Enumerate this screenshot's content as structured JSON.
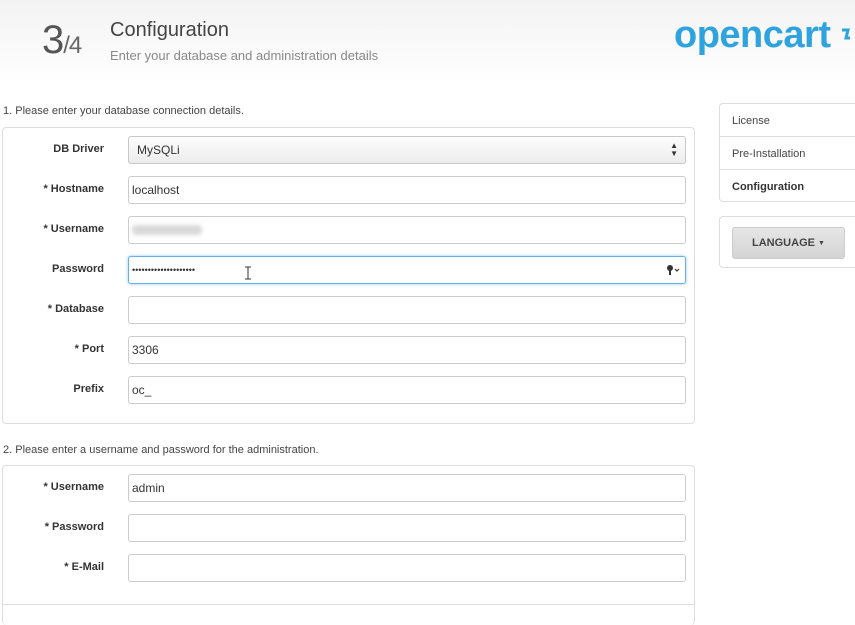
{
  "header": {
    "step_current": "3",
    "step_total": "/4",
    "title": "Configuration",
    "subtitle": "Enter your database and administration details",
    "logo_text": "opencart",
    "logo_color": "#2fa3dd"
  },
  "db_section": {
    "heading": "1. Please enter your database connection details.",
    "fields": {
      "driver": {
        "label": "DB Driver",
        "value": "MySQLi"
      },
      "hostname": {
        "label": "* Hostname",
        "value": "localhost"
      },
      "username": {
        "label": "* Username",
        "value": ""
      },
      "password": {
        "label": "Password",
        "value": "••••••••••••••••••••"
      },
      "database": {
        "label": "* Database",
        "value": ""
      },
      "port": {
        "label": "* Port",
        "value": "3306"
      },
      "prefix": {
        "label": "Prefix",
        "value": "oc_"
      }
    }
  },
  "admin_section": {
    "heading": "2. Please enter a username and password for the administration.",
    "fields": {
      "username": {
        "label": "* Username",
        "value": "admin"
      },
      "password": {
        "label": "* Password",
        "value": ""
      },
      "email": {
        "label": "* E-Mail",
        "value": ""
      }
    }
  },
  "sidebar": {
    "steps": [
      {
        "label": "License"
      },
      {
        "label": "Pre-Installation"
      },
      {
        "label": "Configuration"
      }
    ],
    "language_button": "LANGUAGE"
  },
  "icons": {
    "select_arrows": "updown-arrows-icon",
    "password_key": "key-icon",
    "cursor": "text-cursor-icon"
  },
  "colors": {
    "focus_border": "#66afe9",
    "panel_border": "#dddddd"
  }
}
